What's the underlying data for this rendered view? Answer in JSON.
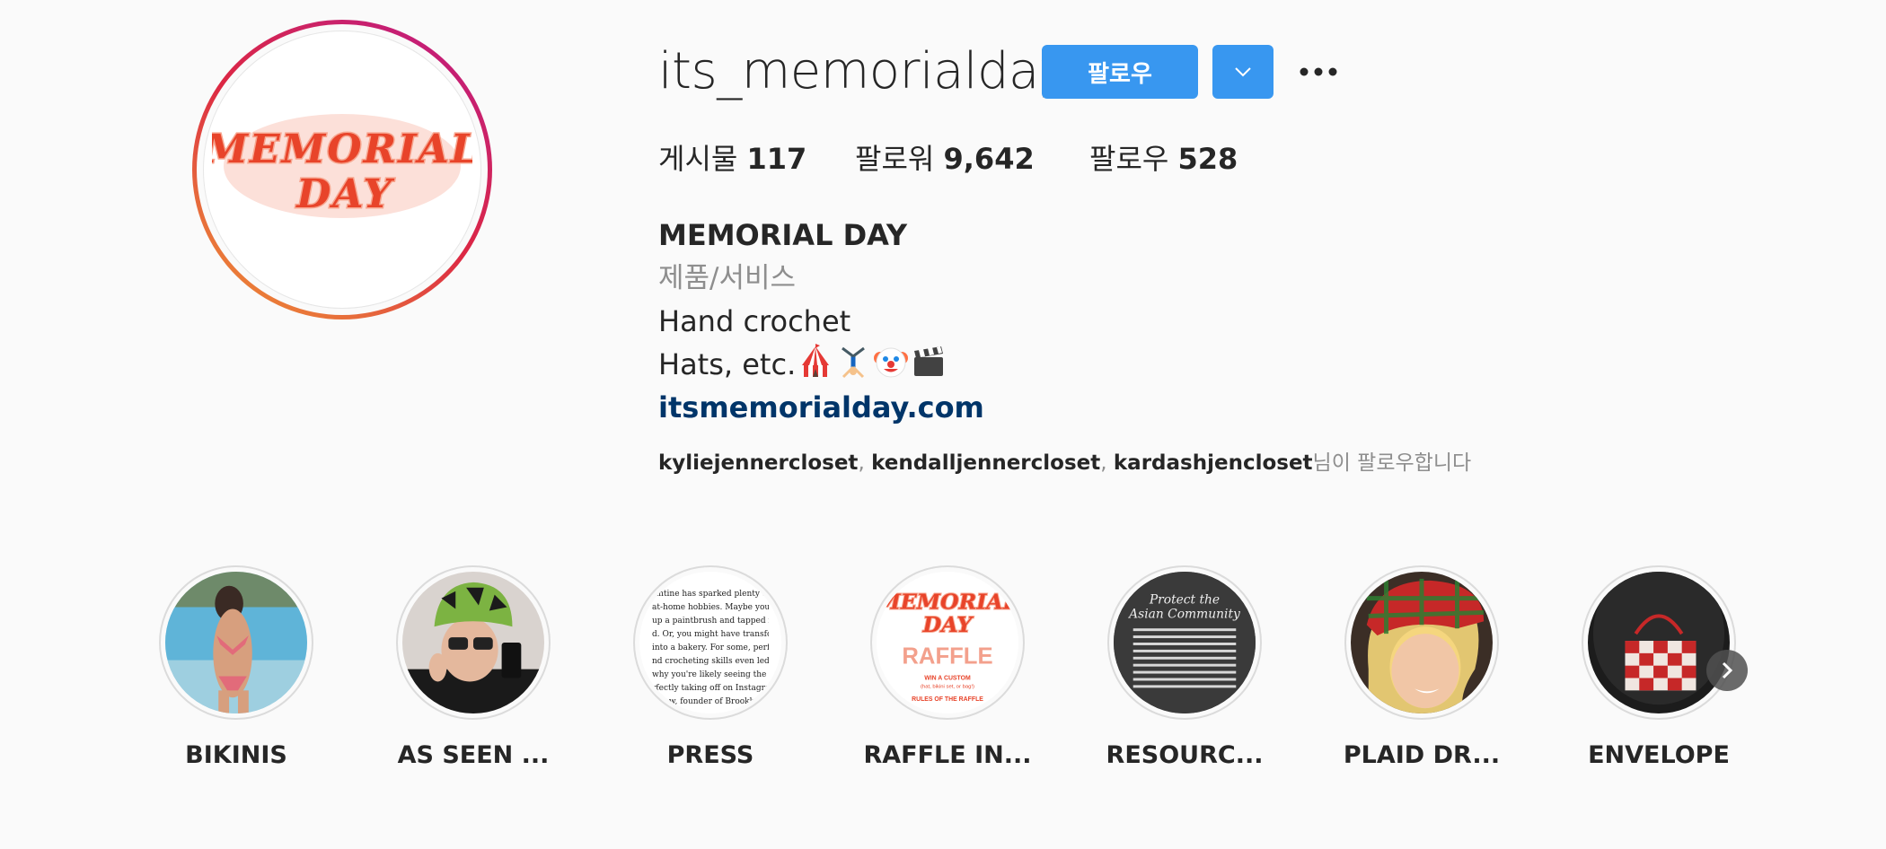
{
  "profile": {
    "username": "its_memorialday",
    "follow_label": "팔로우",
    "avatar_text_line1": "MEMORIAL",
    "avatar_text_line2": "DAY"
  },
  "stats": {
    "posts_label": "게시물",
    "posts_value": "117",
    "followers_label": "팔로워",
    "followers_value": "9,642",
    "following_label": "팔로우",
    "following_value": "528"
  },
  "bio": {
    "name": "MEMORIAL DAY",
    "category": "제품/서비스",
    "line1": "Hand crochet",
    "line2": "Hats, etc.",
    "emojis": [
      "circus-tent-emoji",
      "cartwheel-emoji",
      "clown-face-emoji",
      "clapper-board-emoji"
    ],
    "link": "itsmemorialday.com"
  },
  "followed_by": {
    "accounts": [
      "kyliejennercloset",
      "kendalljennercloset",
      "kardashjencloset"
    ],
    "separator": ", ",
    "suffix": "님이 팔로우합니다"
  },
  "highlights": [
    {
      "label": "BIKINIS",
      "thumb": "bikini-photo"
    },
    {
      "label": "AS SEEN ...",
      "thumb": "green-hat-selfie-photo"
    },
    {
      "label": "PRESS",
      "thumb": "press-article-text"
    },
    {
      "label": "RAFFLE IN...",
      "thumb": "raffle-graphic",
      "thumb_text1": "MEMORIAL",
      "thumb_text2": "DAY",
      "thumb_text3": "RAFFLE",
      "thumb_text4": "WIN A CUSTOM",
      "thumb_text5": "(hat, bikini set, or bag!)",
      "thumb_text6": "RULES OF THE RAFFLE"
    },
    {
      "label": "RESOURC...",
      "thumb": "asian-community-graphic",
      "thumb_text1": "Protect the",
      "thumb_text2": "Asian Community"
    },
    {
      "label": "PLAID DR...",
      "thumb": "plaid-hat-photo"
    },
    {
      "label": "ENVELOPE",
      "thumb": "checkered-bag-photo"
    }
  ],
  "press_text": [
    "antine has sparked plenty o",
    "at-home hobbies. Maybe you pick",
    "up a paintbrush and tapped into you",
    "d. Or, you might have transformed your",
    "into a bakery. For some, perfecting their",
    "nd crocheting skills even led to a business",
    "why you're likely seeing the knit hat",
    "rfectly taking off on Instagram.",
    "",
    "now, founder of Brooklyn"
  ],
  "colors": {
    "accent_blue": "#3897f0",
    "link_blue": "#003569",
    "text_primary": "#262626",
    "text_secondary": "#8e8e8e",
    "background": "#fafafa"
  }
}
